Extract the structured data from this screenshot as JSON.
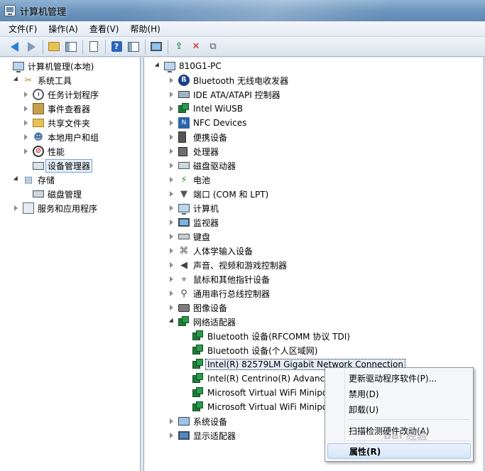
{
  "window": {
    "title": "计算机管理"
  },
  "menu": [
    "文件(F)",
    "操作(A)",
    "查看(V)",
    "帮助(H)"
  ],
  "left_tree": [
    {
      "label": "计算机管理(本地)",
      "level": 0,
      "expander": "none",
      "icon": "computer"
    },
    {
      "label": "系统工具",
      "level": 1,
      "expander": "open",
      "icon": "tools"
    },
    {
      "label": "任务计划程序",
      "level": 2,
      "expander": "closed",
      "icon": "clock"
    },
    {
      "label": "事件查看器",
      "level": 2,
      "expander": "closed",
      "icon": "event"
    },
    {
      "label": "共享文件夹",
      "level": 2,
      "expander": "closed",
      "icon": "share"
    },
    {
      "label": "本地用户和组",
      "level": 2,
      "expander": "closed",
      "icon": "users"
    },
    {
      "label": "性能",
      "level": 2,
      "expander": "closed",
      "icon": "perf"
    },
    {
      "label": "设备管理器",
      "level": 2,
      "expander": "none",
      "icon": "devmgr",
      "selected": true
    },
    {
      "label": "存储",
      "level": 1,
      "expander": "open",
      "icon": "storage"
    },
    {
      "label": "磁盘管理",
      "level": 2,
      "expander": "none",
      "icon": "disk"
    },
    {
      "label": "服务和应用程序",
      "level": 1,
      "expander": "closed",
      "icon": "services"
    }
  ],
  "right_tree": [
    {
      "label": "810G1-PC",
      "level": 0,
      "expander": "open",
      "icon": "computer"
    },
    {
      "label": "Bluetooth 无线电收发器",
      "level": 1,
      "expander": "closed",
      "icon": "bt"
    },
    {
      "label": "IDE ATA/ATAPI 控制器",
      "level": 1,
      "expander": "closed",
      "icon": "ide"
    },
    {
      "label": "Intel WiUSB",
      "level": 1,
      "expander": "closed",
      "icon": "net"
    },
    {
      "label": "NFC Devices",
      "level": 1,
      "expander": "closed",
      "icon": "nfc"
    },
    {
      "label": "便携设备",
      "level": 1,
      "expander": "closed",
      "icon": "portable"
    },
    {
      "label": "处理器",
      "level": 1,
      "expander": "closed",
      "icon": "cpu"
    },
    {
      "label": "磁盘驱动器",
      "level": 1,
      "expander": "closed",
      "icon": "disk"
    },
    {
      "label": "电池",
      "level": 1,
      "expander": "closed",
      "icon": "battery"
    },
    {
      "label": "端口 (COM 和 LPT)",
      "level": 1,
      "expander": "closed",
      "icon": "port"
    },
    {
      "label": "计算机",
      "level": 1,
      "expander": "closed",
      "icon": "computer"
    },
    {
      "label": "监视器",
      "level": 1,
      "expander": "closed",
      "icon": "monitor"
    },
    {
      "label": "键盘",
      "level": 1,
      "expander": "closed",
      "icon": "keyboard"
    },
    {
      "label": "人体学输入设备",
      "level": 1,
      "expander": "closed",
      "icon": "hid"
    },
    {
      "label": "声音、视频和游戏控制器",
      "level": 1,
      "expander": "closed",
      "icon": "sound"
    },
    {
      "label": "鼠标和其他指针设备",
      "level": 1,
      "expander": "closed",
      "icon": "mouse"
    },
    {
      "label": "通用串行总线控制器",
      "level": 1,
      "expander": "closed",
      "icon": "usb"
    },
    {
      "label": "图像设备",
      "level": 1,
      "expander": "closed",
      "icon": "camera"
    },
    {
      "label": "网络适配器",
      "level": 1,
      "expander": "open",
      "icon": "net"
    },
    {
      "label": "Bluetooth 设备(RFCOMM 协议 TDI)",
      "level": 2,
      "expander": "none",
      "icon": "net"
    },
    {
      "label": "Bluetooth 设备(个人区域网)",
      "level": 2,
      "expander": "none",
      "icon": "net"
    },
    {
      "label": "Intel(R) 82579LM Gigabit Network Connection",
      "level": 2,
      "expander": "none",
      "icon": "net",
      "hilite": true
    },
    {
      "label": "Intel(R) Centrino(R) Advanced-",
      "level": 2,
      "expander": "none",
      "icon": "net"
    },
    {
      "label": "Microsoft Virtual WiFi Minipor",
      "level": 2,
      "expander": "none",
      "icon": "net"
    },
    {
      "label": "Microsoft Virtual WiFi Minipor",
      "level": 2,
      "expander": "none",
      "icon": "net"
    },
    {
      "label": "系统设备",
      "level": 1,
      "expander": "closed",
      "icon": "sys"
    },
    {
      "label": "显示适配器",
      "level": 1,
      "expander": "closed",
      "icon": "display"
    }
  ],
  "context_menu": {
    "update_driver": "更新驱动程序软件(P)...",
    "disable": "禁用(D)",
    "uninstall": "卸载(U)",
    "scan": "扫描检测硬件改动(A)",
    "properties": "属性(R)"
  },
  "watermark": "Bai 经验"
}
